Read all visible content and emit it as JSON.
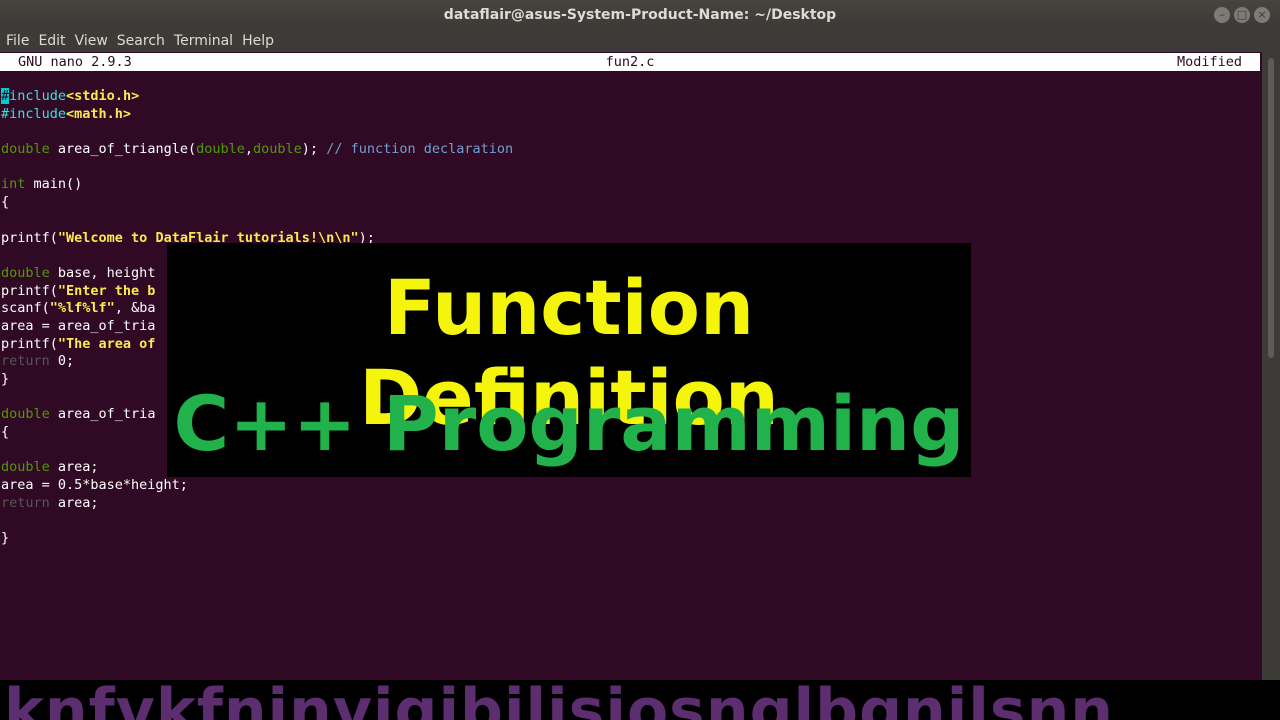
{
  "window": {
    "title": "dataflair@asus-System-Product-Name: ~/Desktop",
    "controls": [
      "minimize-icon",
      "maximize-icon",
      "close-icon"
    ]
  },
  "menu": {
    "items": [
      "File",
      "Edit",
      "View",
      "Search",
      "Terminal",
      "Help"
    ]
  },
  "nano": {
    "version": "GNU nano 2.9.3",
    "filename": "fun2.c",
    "status": "Modified"
  },
  "code": {
    "lines": [
      [
        "#",
        "include",
        "<stdio.h>"
      ],
      [
        "#include",
        "<math.h>"
      ],
      [],
      [
        "double",
        " area_of_triangle(",
        "double",
        ",",
        "double",
        "); ",
        "// function declaration"
      ],
      [],
      [
        "int",
        " main()"
      ],
      [
        "{"
      ],
      [],
      [
        "printf(",
        "\"Welcome to DataFlair tutorials!\\n\\n\"",
        ");"
      ],
      [],
      [
        "double",
        " base, height"
      ],
      [
        "printf(",
        "\"Enter the b"
      ],
      [
        "scanf(",
        "\"%lf%lf\"",
        ", &ba"
      ],
      [
        "area = area_of_tria"
      ],
      [
        "printf(",
        "\"The area of"
      ],
      [
        "return",
        " 0;"
      ],
      [
        "}"
      ],
      [],
      [
        "double",
        " area_of_tria"
      ],
      [
        "{"
      ],
      [],
      [
        "double",
        " area;"
      ],
      [
        "area = 0.5*base*height;"
      ],
      [
        "return",
        " area;"
      ],
      [],
      [
        "}"
      ]
    ]
  },
  "banner": {
    "line1": "Function Definition",
    "line2": "C++ Programming"
  },
  "ticker": {
    "text": "knfvkfninvigibilisiosnglbgnilsnn"
  },
  "colors": {
    "terminal_bg": "#300a24",
    "keyword": "#4e9a06",
    "preprocessor": "#34e2e2",
    "string": "#fce94f",
    "comment": "#729fcf",
    "banner_line1": "#f5f50b",
    "banner_line2": "#21b24b"
  }
}
